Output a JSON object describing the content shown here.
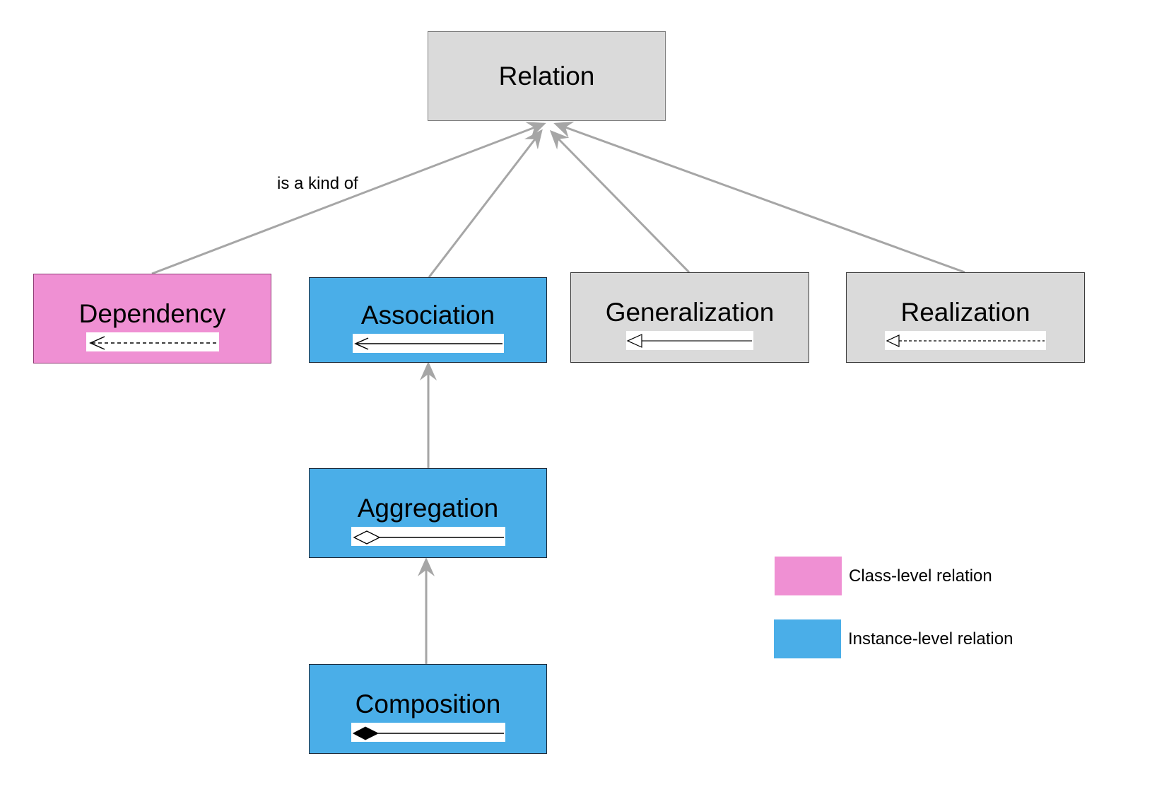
{
  "diagram": {
    "root": {
      "id": "relation",
      "label": "Relation",
      "fill": "#dadada"
    },
    "nodes": [
      {
        "id": "dependency",
        "label": "Dependency",
        "fill": "#ef90d3",
        "level": "class",
        "notation": "dashed-open-arrow"
      },
      {
        "id": "association",
        "label": "Association",
        "fill": "#4aaee8",
        "level": "instance",
        "notation": "solid-open-arrow"
      },
      {
        "id": "generalization",
        "label": "Generalization",
        "fill": "#dadada",
        "level": "none",
        "notation": "solid-hollow-triangle"
      },
      {
        "id": "realization",
        "label": "Realization",
        "fill": "#dadada",
        "level": "none",
        "notation": "dashed-hollow-triangle"
      },
      {
        "id": "aggregation",
        "label": "Aggregation",
        "fill": "#4aaee8",
        "level": "instance",
        "notation": "hollow-diamond"
      },
      {
        "id": "composition",
        "label": "Composition",
        "fill": "#4aaee8",
        "level": "instance",
        "notation": "filled-diamond"
      }
    ],
    "edges": [
      {
        "from": "dependency",
        "to": "relation",
        "label": "is a kind of"
      },
      {
        "from": "association",
        "to": "relation",
        "label": ""
      },
      {
        "from": "generalization",
        "to": "relation",
        "label": ""
      },
      {
        "from": "realization",
        "to": "relation",
        "label": ""
      },
      {
        "from": "aggregation",
        "to": "association",
        "label": ""
      },
      {
        "from": "composition",
        "to": "aggregation",
        "label": ""
      }
    ],
    "edge_label": "is a kind of",
    "edge_color": "#a6a6a6"
  },
  "legend": [
    {
      "label": "Class-level relation",
      "color": "#ef90d3"
    },
    {
      "label": "Instance-level relation",
      "color": "#4aaee8"
    }
  ]
}
